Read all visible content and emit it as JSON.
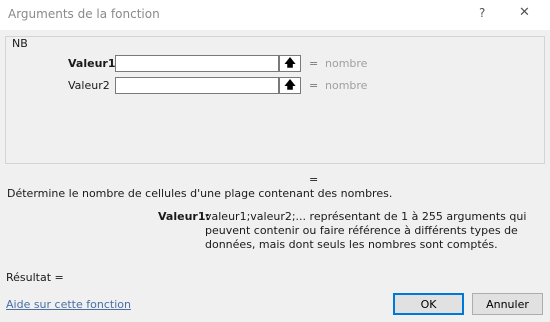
{
  "window": {
    "title": "Arguments de la fonction",
    "help_glyph": "?",
    "close_glyph": "✕"
  },
  "function": {
    "name": "NB"
  },
  "arguments": [
    {
      "label": "Valeur1",
      "value": "",
      "equals": "=",
      "hint": "nombre",
      "ref_glyph": "🡅"
    },
    {
      "label": "Valeur2",
      "value": "",
      "equals": "=",
      "hint": "nombre",
      "ref_glyph": "🡅"
    }
  ],
  "result_equals": "=",
  "description": "Détermine le nombre de cellules d'une plage contenant des nombres.",
  "argument_help": {
    "label": "Valeur1:",
    "text": "valeur1;valeur2;... représentant de 1 à 255 arguments qui peuvent contenir ou faire référence à différents types de données, mais dont seuls les nombres sont comptés."
  },
  "result_label": "Résultat =",
  "help_link": "Aide sur cette fonction",
  "buttons": {
    "ok": "OK",
    "cancel": "Annuler"
  },
  "colors": {
    "ok_border": "#0078d7",
    "link": "#4a6fa5",
    "hint": "#a0a0a0"
  }
}
